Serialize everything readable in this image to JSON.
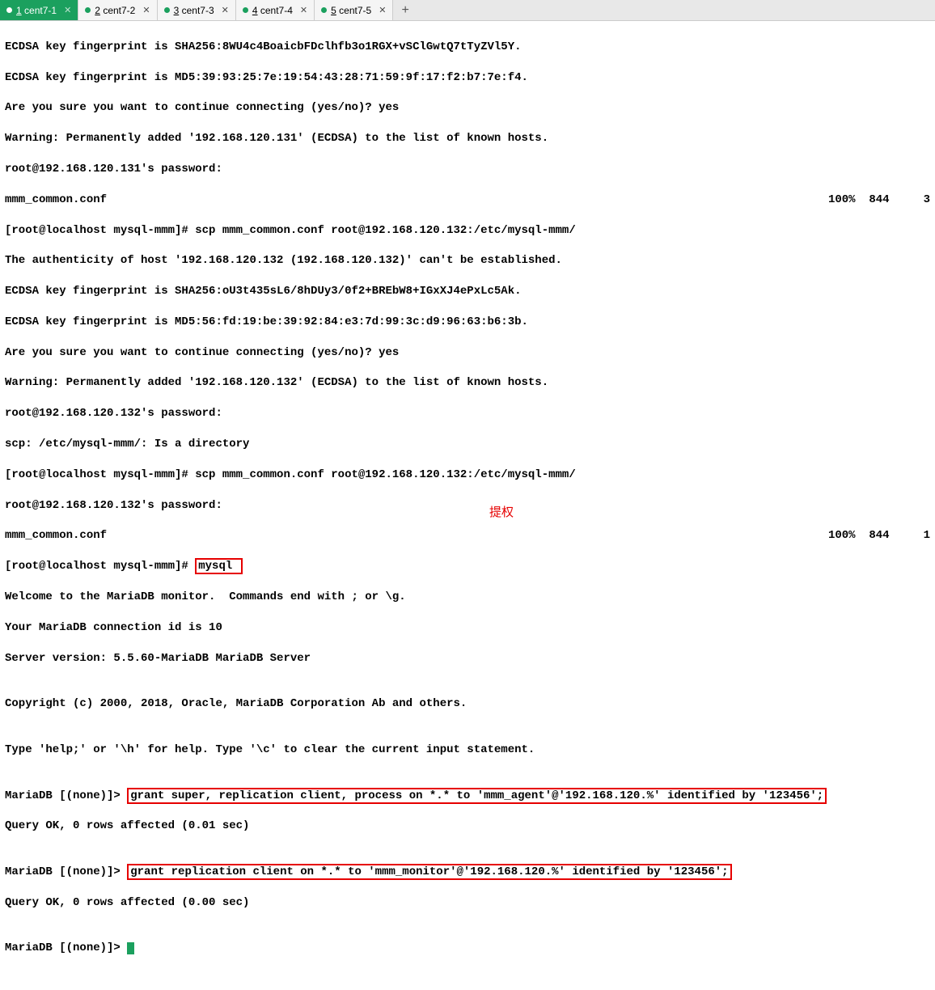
{
  "tabs": [
    {
      "num": "1",
      "label": "cent7-1",
      "active": true
    },
    {
      "num": "2",
      "label": "cent7-2",
      "active": false
    },
    {
      "num": "3",
      "label": "cent7-3",
      "active": false
    },
    {
      "num": "4",
      "label": "cent7-4",
      "active": false
    },
    {
      "num": "5",
      "label": "cent7-5",
      "active": false
    }
  ],
  "terminal": {
    "l1": "ECDSA key fingerprint is SHA256:8WU4c4BoaicbFDclhfb3o1RGX+vSClGwtQ7tTyZVl5Y.",
    "l2": "ECDSA key fingerprint is MD5:39:93:25:7e:19:54:43:28:71:59:9f:17:f2:b7:7e:f4.",
    "l3": "Are you sure you want to continue connecting (yes/no)? yes",
    "l4": "Warning: Permanently added '192.168.120.131' (ECDSA) to the list of known hosts.",
    "l5": "root@192.168.120.131's password:",
    "l6": "mmm_common.conf",
    "l6_stats": "100%  844     3",
    "l7": "[root@localhost mysql-mmm]# scp mmm_common.conf root@192.168.120.132:/etc/mysql-mmm/",
    "l8": "The authenticity of host '192.168.120.132 (192.168.120.132)' can't be established.",
    "l9": "ECDSA key fingerprint is SHA256:oU3t435sL6/8hDUy3/0f2+BREbW8+IGxXJ4ePxLc5Ak.",
    "l10": "ECDSA key fingerprint is MD5:56:fd:19:be:39:92:84:e3:7d:99:3c:d9:96:63:b6:3b.",
    "l11": "Are you sure you want to continue connecting (yes/no)? yes",
    "l12": "Warning: Permanently added '192.168.120.132' (ECDSA) to the list of known hosts.",
    "l13": "root@192.168.120.132's password:",
    "l14": "scp: /etc/mysql-mmm/: Is a directory",
    "l15": "[root@localhost mysql-mmm]# scp mmm_common.conf root@192.168.120.132:/etc/mysql-mmm/",
    "l16": "root@192.168.120.132's password:",
    "l17": "mmm_common.conf",
    "l17_stats": "100%  844     1",
    "l18_prompt": "[root@localhost mysql-mmm]# ",
    "l18_cmd": "mysql ",
    "l19": "Welcome to the MariaDB monitor.  Commands end with ; or \\g.",
    "l20": "Your MariaDB connection id is 10",
    "l21": "Server version: 5.5.60-MariaDB MariaDB Server",
    "l22": "",
    "l23": "Copyright (c) 2000, 2018, Oracle, MariaDB Corporation Ab and others.",
    "l24": "",
    "l25": "Type 'help;' or '\\h' for help. Type '\\c' to clear the current input statement.",
    "l26": "",
    "l27_prompt": "MariaDB [(none)]> ",
    "l27_cmd": "grant super, replication client, process on *.* to 'mmm_agent'@'192.168.120.%' identified by '123456';",
    "l28": "Query OK, 0 rows affected (0.01 sec)",
    "l29": "",
    "l30_prompt": "MariaDB [(none)]> ",
    "l30_cmd": "grant replication client on *.* to 'mmm_monitor'@'192.168.120.%' identified by '123456';",
    "l31": "Query OK, 0 rows affected (0.00 sec)",
    "l32": "",
    "l33": "MariaDB [(none)]> "
  },
  "annotation": "提权",
  "colors": {
    "tab_active": "#1ba05e",
    "highlight_box": "#e60000",
    "cursor": "#1ba05e"
  }
}
